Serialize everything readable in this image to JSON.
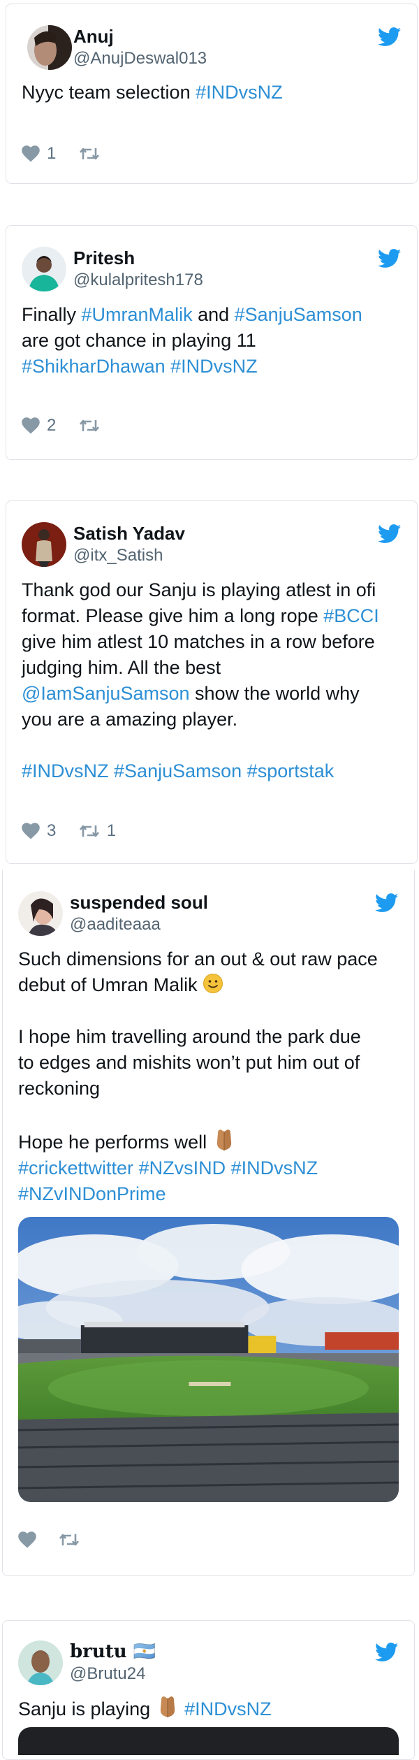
{
  "tweets": [
    {
      "name": "Anuj",
      "handle": "@AnujDeswal013",
      "lines": [
        [
          {
            "t": "Nyyc team selection "
          },
          {
            "t": "#INDvsNZ",
            "tag": true
          }
        ]
      ],
      "likes": "1",
      "retweets": ""
    },
    {
      "name": "Pritesh",
      "handle": "@kulalpritesh178",
      "lines": [
        [
          {
            "t": "Finally "
          },
          {
            "t": "#UmranMalik",
            "tag": true
          },
          {
            "t": " and "
          },
          {
            "t": "#SanjuSamson",
            "tag": true
          }
        ],
        [
          {
            "t": "are got chance in playing 11"
          }
        ],
        [
          {
            "t": "#ShikharDhawan",
            "tag": true
          },
          {
            "t": " "
          },
          {
            "t": "#INDvsNZ",
            "tag": true
          }
        ]
      ],
      "likes": "2",
      "retweets": ""
    },
    {
      "name": "Satish Yadav",
      "handle": "@itx_Satish",
      "lines": [
        [
          {
            "t": "Thank god our Sanju is playing atlest in ofi"
          }
        ],
        [
          {
            "t": "format. Please give him a long rope "
          },
          {
            "t": "#BCCI",
            "tag": true
          }
        ],
        [
          {
            "t": "give him atlest 10 matches in a row before"
          }
        ],
        [
          {
            "t": "judging him. All the best"
          }
        ],
        [
          {
            "t": "@IamSanjuSamson",
            "tag": true
          },
          {
            "t": " show the world why"
          }
        ],
        [
          {
            "t": "you are a amazing player."
          }
        ],
        [
          {
            "t": "#INDvsNZ",
            "tag": true,
            "gap": true
          },
          {
            "t": " "
          },
          {
            "t": "#SanjuSamson",
            "tag": true
          },
          {
            "t": " "
          },
          {
            "t": "#sportstak",
            "tag": true
          }
        ]
      ],
      "likes": "3",
      "retweets": "1"
    },
    {
      "name": "suspended soul",
      "handle": "@aaditeaaa",
      "lines": [
        [
          {
            "t": "Such dimensions for an out & out raw pace"
          }
        ],
        [
          {
            "t": "debut of Umran Malik "
          },
          {
            "emoji": "smile"
          }
        ],
        [
          {
            "t": "I hope him travelling around the park due",
            "gap": true
          }
        ],
        [
          {
            "t": "to edges and mishits won’t put him out of"
          }
        ],
        [
          {
            "t": "reckoning"
          }
        ],
        [
          {
            "t": "Hope he performs well ",
            "gap": true
          },
          {
            "emoji": "pray"
          }
        ],
        [
          {
            "t": "#crickettwitter",
            "tag": true
          },
          {
            "t": " "
          },
          {
            "t": "#NZvsIND",
            "tag": true
          },
          {
            "t": " "
          },
          {
            "t": "#INDvsNZ",
            "tag": true
          }
        ],
        [
          {
            "t": "#NZvINDonPrime",
            "tag": true
          }
        ]
      ],
      "likes": "",
      "retweets": ""
    },
    {
      "name": "brutu 🇦🇷",
      "handle": "@Brutu24",
      "lines": [
        [
          {
            "t": "Sanju is playing "
          },
          {
            "emoji": "pray"
          },
          {
            "t": " "
          },
          {
            "t": "#INDvsNZ",
            "tag": true
          }
        ]
      ],
      "likes": "",
      "retweets": ""
    }
  ],
  "icons": {
    "brand": "twitter-bird-icon",
    "like": "heart-icon",
    "retweet": "retweet-icon"
  },
  "colors": {
    "link": "#2d8fd5",
    "twitter_blue": "#1d9bf0",
    "muted": "#536471",
    "action_gray": "#5b7083"
  }
}
